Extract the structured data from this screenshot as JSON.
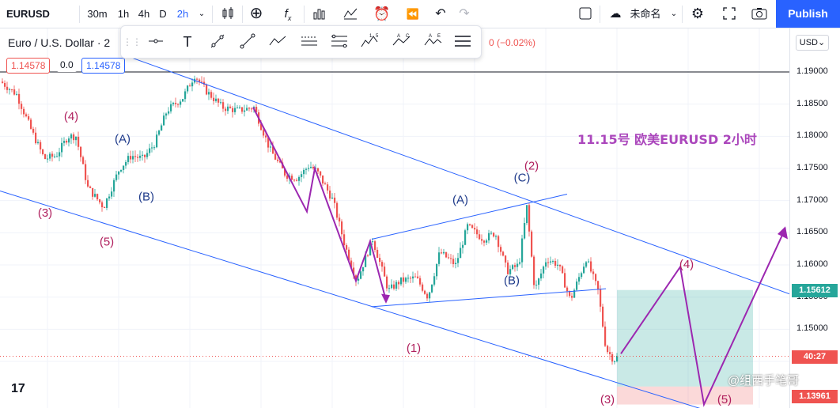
{
  "toolbar": {
    "symbol": "EURUSD",
    "intervals": [
      "30m",
      "1h",
      "4h",
      "D",
      "2h"
    ],
    "layout_name": "未命名",
    "publish_label": "Publish"
  },
  "legend": {
    "title": "Euro / U.S. Dollar · 2",
    "change": "0 (−0.02%)",
    "bid": "1.14578",
    "spread": "0.0",
    "ask": "1.14578"
  },
  "price_axis": {
    "currency": "USD",
    "ticks": [
      "1.19000",
      "1.18500",
      "1.18000",
      "1.17500",
      "1.17000",
      "1.16500",
      "1.16000",
      "1.15500",
      "1.15000",
      "1.14500"
    ],
    "labels": {
      "upper": "1.15612",
      "countdown": "40:27",
      "lower": "1.13961"
    }
  },
  "annotation_title": "11.15号 欧美EURUSD 2小时",
  "watermark": "@组西手笔哥",
  "chart_data": {
    "type": "candlestick",
    "symbol": "EURUSD",
    "timeframe": "2h",
    "ylim": [
      1.1375,
      1.1925
    ],
    "y_ticks": [
      1.19,
      1.185,
      1.18,
      1.175,
      1.17,
      1.165,
      1.16,
      1.155,
      1.15,
      1.145
    ],
    "path_points": [
      [
        0,
        1.1885
      ],
      [
        20,
        1.1865
      ],
      [
        40,
        1.1805
      ],
      [
        55,
        1.1765
      ],
      [
        70,
        1.177
      ],
      [
        85,
        1.18
      ],
      [
        95,
        1.18
      ],
      [
        110,
        1.172
      ],
      [
        130,
        1.169
      ],
      [
        150,
        1.175
      ],
      [
        165,
        1.177
      ],
      [
        180,
        1.1765
      ],
      [
        195,
        1.179
      ],
      [
        210,
        1.184
      ],
      [
        230,
        1.186
      ],
      [
        245,
        1.1895
      ],
      [
        260,
        1.187
      ],
      [
        280,
        1.1845
      ],
      [
        300,
        1.184
      ],
      [
        320,
        1.1845
      ],
      [
        340,
        1.178
      ],
      [
        360,
        1.174
      ],
      [
        375,
        1.1735
      ],
      [
        390,
        1.1755
      ],
      [
        400,
        1.1745
      ],
      [
        420,
        1.17
      ],
      [
        435,
        1.163
      ],
      [
        450,
        1.1575
      ],
      [
        470,
        1.164
      ],
      [
        490,
        1.156
      ],
      [
        505,
        1.1575
      ],
      [
        525,
        1.158
      ],
      [
        540,
        1.155
      ],
      [
        555,
        1.162
      ],
      [
        575,
        1.16
      ],
      [
        590,
        1.166
      ],
      [
        610,
        1.164
      ],
      [
        625,
        1.165
      ],
      [
        640,
        1.159
      ],
      [
        655,
        1.16
      ],
      [
        665,
        1.169
      ],
      [
        675,
        1.156
      ],
      [
        690,
        1.161
      ],
      [
        705,
        1.16
      ],
      [
        720,
        1.1545
      ],
      [
        740,
        1.161
      ],
      [
        755,
        1.156
      ],
      [
        765,
        1.147
      ],
      [
        775,
        1.1452
      ],
      [
        780,
        1.1458
      ]
    ],
    "wave_labels": [
      {
        "text": "(4)",
        "x": 90,
        "y": 1.1825,
        "color": "#b0205e"
      },
      {
        "text": "(A)",
        "x": 155,
        "y": 1.179,
        "color": "#1e3a8a"
      },
      {
        "text": "(B)",
        "x": 185,
        "y": 1.17,
        "color": "#1e3a8a"
      },
      {
        "text": "(3)",
        "x": 57,
        "y": 1.1675,
        "color": "#b0205e"
      },
      {
        "text": "(5)",
        "x": 135,
        "y": 1.163,
        "color": "#b0205e"
      },
      {
        "text": "(A)",
        "x": 582,
        "y": 1.1695,
        "color": "#1e3a8a"
      },
      {
        "text": "(C)",
        "x": 660,
        "y": 1.173,
        "color": "#1e3a8a"
      },
      {
        "text": "(2)",
        "x": 672,
        "y": 1.1748,
        "color": "#b0205e"
      },
      {
        "text": "(B)",
        "x": 647,
        "y": 1.157,
        "color": "#1e3a8a"
      },
      {
        "text": "(1)",
        "x": 523,
        "y": 1.1465,
        "color": "#b0205e"
      },
      {
        "text": "(4)",
        "x": 868,
        "y": 1.1595,
        "color": "#b0205e"
      },
      {
        "text": "(3)",
        "x": 768,
        "y": 1.1385,
        "color": "#b0205e"
      },
      {
        "text": "(5)",
        "x": 916,
        "y": 1.1385,
        "color": "#b0205e"
      }
    ]
  }
}
